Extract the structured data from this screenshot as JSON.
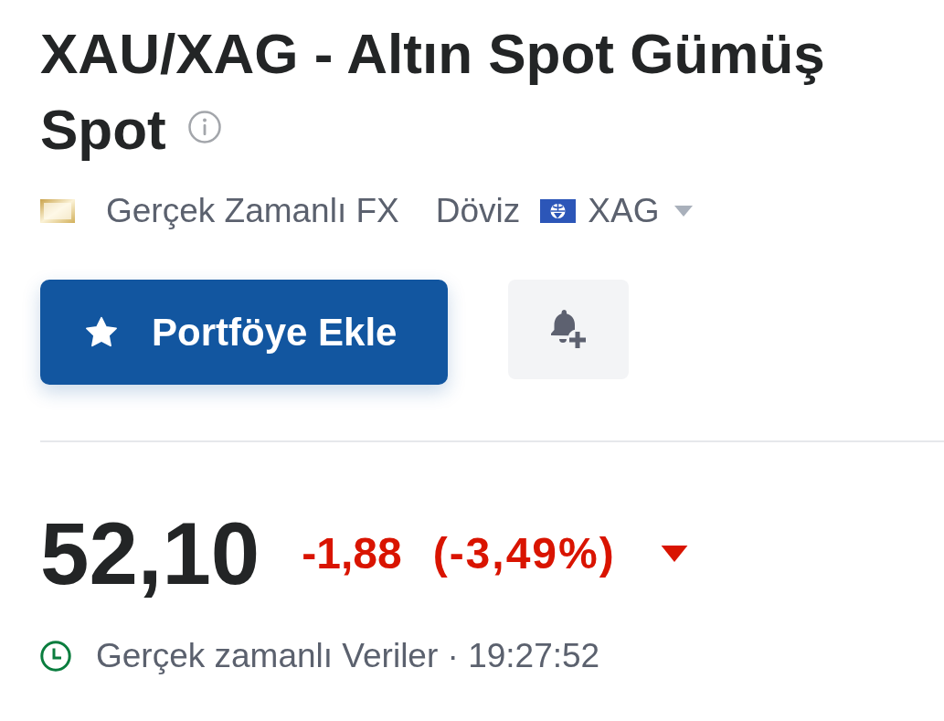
{
  "title": "XAU/XAG - Altın Spot Gümüş Spot",
  "meta": {
    "source": "Gerçek Zamanlı FX",
    "category": "Döviz",
    "currency": "XAG"
  },
  "portfolio_button": {
    "label": "Portföye Ekle"
  },
  "quote": {
    "price": "52,10",
    "change": "-1,88",
    "change_percent": "(-3,49%)",
    "falling": true
  },
  "status": {
    "text": "Gerçek zamanlı Veriler · 19:27:52"
  }
}
